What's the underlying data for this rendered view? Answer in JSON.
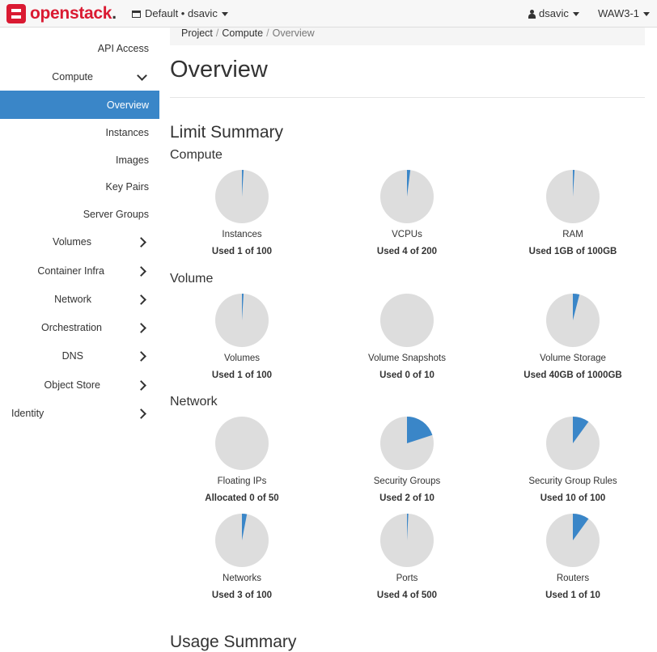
{
  "navbar": {
    "brand": "openstack",
    "brand_dot": ".",
    "project_label": "Default • dsavic",
    "user_label": "dsavic",
    "region_label": "WAW3-1"
  },
  "sidebar": {
    "items": [
      {
        "label": "API Access"
      },
      {
        "label": "Compute"
      },
      {
        "label": "Overview"
      },
      {
        "label": "Instances"
      },
      {
        "label": "Images"
      },
      {
        "label": "Key Pairs"
      },
      {
        "label": "Server Groups"
      },
      {
        "label": "Volumes"
      },
      {
        "label": "Container Infra"
      },
      {
        "label": "Network"
      },
      {
        "label": "Orchestration"
      },
      {
        "label": "DNS"
      },
      {
        "label": "Object Store"
      },
      {
        "label": "Identity"
      }
    ]
  },
  "breadcrumb": {
    "items": [
      "Project",
      "Compute",
      "Overview"
    ],
    "separator": "/"
  },
  "page": {
    "title": "Overview",
    "limit_summary": "Limit Summary",
    "usage_summary": "Usage Summary"
  },
  "colors": {
    "accent": "#3a86c8",
    "pie_bg": "#dddddd",
    "brand": "#da1a32"
  },
  "limits": {
    "compute": {
      "heading": "Compute",
      "items": [
        {
          "name": "Instances",
          "usage": "Used 1 of 100",
          "used": 1,
          "total": 100
        },
        {
          "name": "VCPUs",
          "usage": "Used 4 of 200",
          "used": 4,
          "total": 200
        },
        {
          "name": "RAM",
          "usage": "Used 1GB of 100GB",
          "used": 1,
          "total": 100
        }
      ]
    },
    "volume": {
      "heading": "Volume",
      "items": [
        {
          "name": "Volumes",
          "usage": "Used 1 of 100",
          "used": 1,
          "total": 100
        },
        {
          "name": "Volume Snapshots",
          "usage": "Used 0 of 10",
          "used": 0,
          "total": 10
        },
        {
          "name": "Volume Storage",
          "usage": "Used 40GB of 1000GB",
          "used": 40,
          "total": 1000
        }
      ]
    },
    "network": {
      "heading": "Network",
      "items": [
        {
          "name": "Floating IPs",
          "usage": "Allocated 0 of 50",
          "used": 0,
          "total": 50
        },
        {
          "name": "Security Groups",
          "usage": "Used 2 of 10",
          "used": 2,
          "total": 10
        },
        {
          "name": "Security Group Rules",
          "usage": "Used 10 of 100",
          "used": 10,
          "total": 100
        },
        {
          "name": "Networks",
          "usage": "Used 3 of 100",
          "used": 3,
          "total": 100
        },
        {
          "name": "Ports",
          "usage": "Used 4 of 500",
          "used": 4,
          "total": 500
        },
        {
          "name": "Routers",
          "usage": "Used 1 of 10",
          "used": 1,
          "total": 10
        }
      ]
    }
  }
}
